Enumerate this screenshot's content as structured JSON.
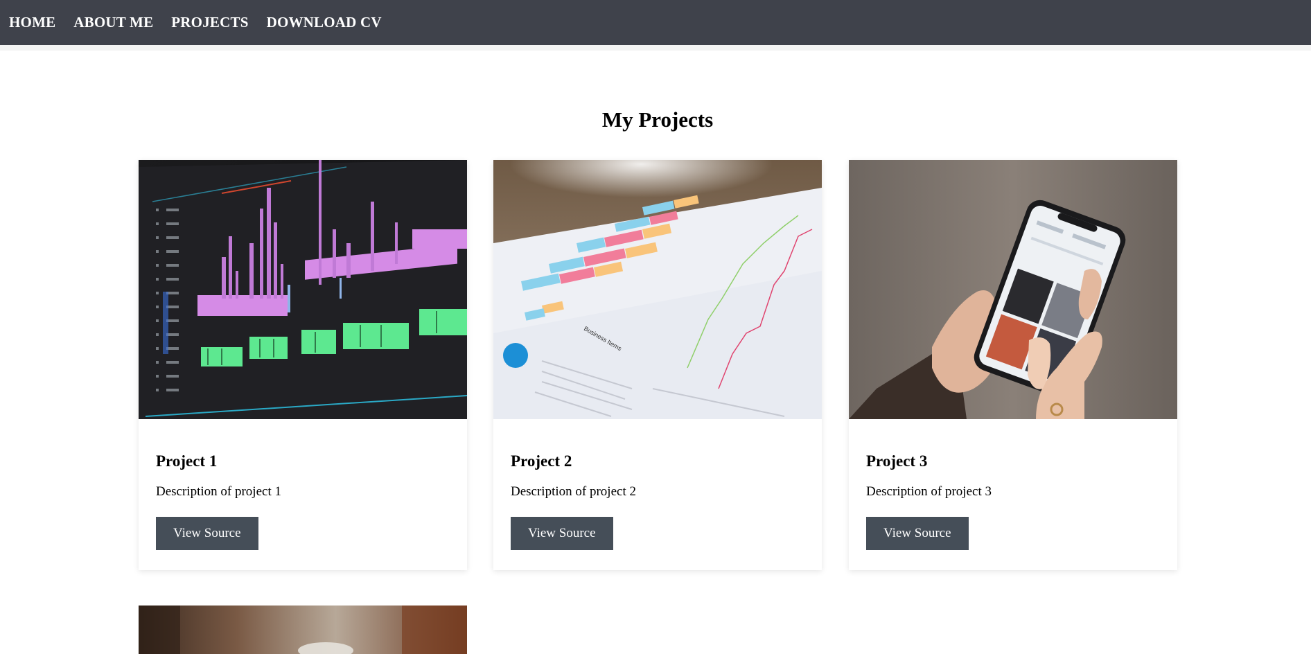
{
  "nav": {
    "items": [
      {
        "label": "HOME"
      },
      {
        "label": "ABOUT ME"
      },
      {
        "label": "PROJECTS"
      },
      {
        "label": "DOWNLOAD CV"
      }
    ]
  },
  "projects_section": {
    "title": "My Projects",
    "cards": [
      {
        "title": "Project 1",
        "description": "Description of project 1",
        "button_label": "View Source",
        "image_icon": "video-timeline-image"
      },
      {
        "title": "Project 2",
        "description": "Description of project 2",
        "button_label": "View Source",
        "image_icon": "business-chart-image"
      },
      {
        "title": "Project 3",
        "description": "Description of project 3",
        "button_label": "View Source",
        "image_icon": "phone-in-hand-image"
      }
    ]
  },
  "colors": {
    "navbar_bg": "#3f424b",
    "button_bg": "#454e58",
    "page_bg": "#ffffff"
  }
}
